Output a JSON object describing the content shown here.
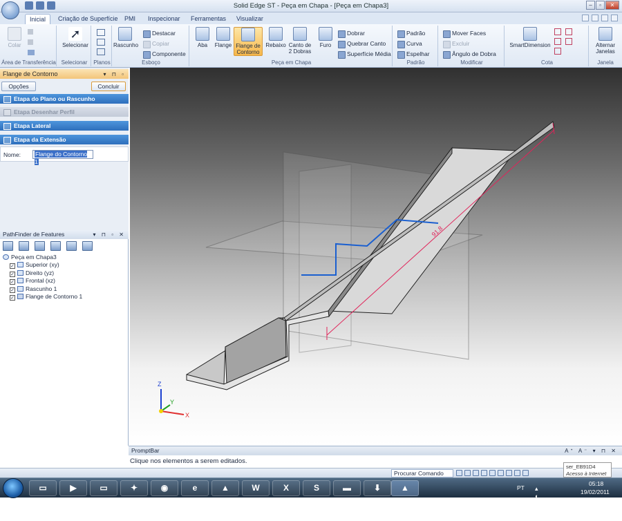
{
  "title_bar": {
    "title": "Solid Edge ST - Peça em Chapa - [Peça em Chapa3]",
    "window_buttons": [
      "–",
      "▫",
      "✕"
    ]
  },
  "ribbon_tabs": [
    "Inicial",
    "Criação de Superfície",
    "PMI",
    "Inspecionar",
    "Ferramentas",
    "Visualizar"
  ],
  "ribbon": {
    "clipboard": {
      "colar": "Colar",
      "label": "Área de Transferência"
    },
    "select": {
      "selecionar": "Selecionar",
      "label": "Selecionar"
    },
    "planos": {
      "label": "Planos"
    },
    "sketch": {
      "rascunho": "Rascunho",
      "destacar": "Destacar",
      "copiar": "Copiar",
      "componente": "Componente",
      "label": "Esboço"
    },
    "sheet": {
      "aba": "Aba",
      "flange": "Flange",
      "flange_contorno_1": "Flange de",
      "flange_contorno_2": "Contorno",
      "rebaixo": "Rebaixo",
      "canto_1": "Canto de",
      "canto_2": "2 Dobras",
      "furo": "Furo",
      "dobrar": "Dobrar",
      "quebrar": "Quebrar Canto",
      "superficie": "Superfície Média",
      "label": "Peça em Chapa"
    },
    "pattern": {
      "padrao": "Padrão",
      "curva": "Curva",
      "espelhar": "Espelhar",
      "label": "Padrão"
    },
    "modify": {
      "mover": "Mover Faces",
      "excluir": "Excluir",
      "angulo": "Ângulo de Dobra",
      "label": "Modificar"
    },
    "dim": {
      "smart": "SmartDimension",
      "label": "Cota"
    },
    "window": {
      "alternar_1": "Alternar",
      "alternar_2": "Janelas",
      "label": "Janela"
    }
  },
  "command_panel": {
    "title": "Flange de Contorno",
    "opcoes": "Opções",
    "concluir": "Concluir",
    "steps": [
      "Etapa do Plano ou Rascunho",
      "Etapa Desenhar Perfil",
      "Etapa Lateral",
      "Etapa da Extensão"
    ],
    "name_label": "Nome:",
    "name_value": "Flange do Contorno 1"
  },
  "pathfinder": {
    "title": "PathFinder de Features",
    "root": "Peça em Chapa3",
    "items": [
      "Superior (xy)",
      "Direito (yz)",
      "Frontal (xz)",
      "Rascunho 1",
      "Flange de Contorno 1"
    ]
  },
  "viewport": {
    "dimension_text": "91.8",
    "axes": {
      "z": "Z",
      "y": "Y",
      "x": "X"
    }
  },
  "promptbar": {
    "title": "PromptBar",
    "text": "Clique nos elementos a serem editados."
  },
  "status": {
    "search_placeholder": "Procurar Comando"
  },
  "tooltip": {
    "line1": "ser_EB91D4",
    "line2": "Acesso à Internet"
  },
  "taskbar": {
    "lang": "PT",
    "time": "05:18",
    "date": "19/02/2011"
  },
  "colors": {
    "accent": "#f6b74b",
    "step_active": "#3a80cc",
    "sketch_blue": "#1a5fd0",
    "dimension": "#e0245a"
  }
}
